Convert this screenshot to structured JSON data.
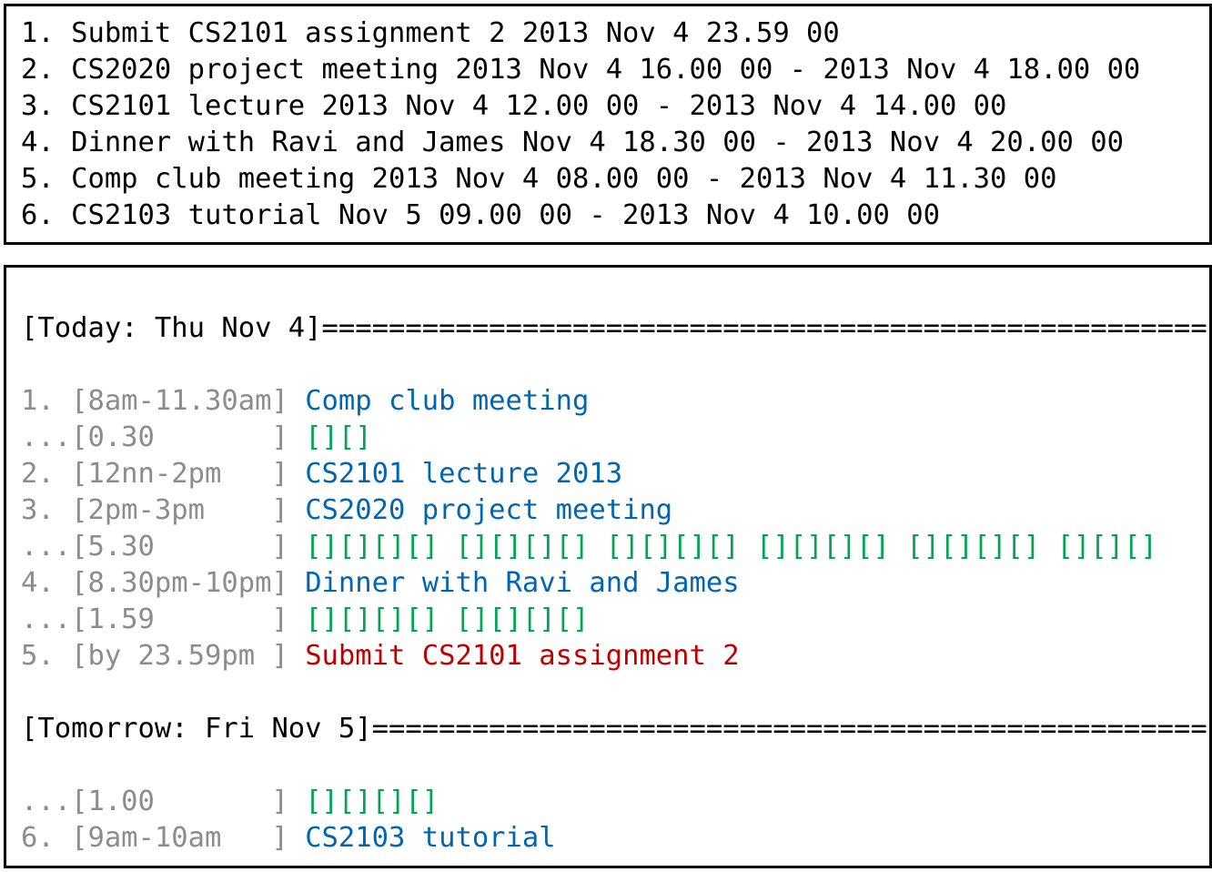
{
  "input_lines": [
    "1. Submit CS2101 assignment 2 2013 Nov 4 23.59 00",
    "2. CS2020 project meeting 2013 Nov 4 16.00 00 - 2013 Nov 4 18.00 00",
    "3. CS2101 lecture 2013 Nov 4 12.00 00 - 2013 Nov 4 14.00 00",
    "4. Dinner with Ravi and James Nov 4 18.30 00 - 2013 Nov 4 20.00 00",
    "5. Comp club meeting 2013 Nov 4 08.00 00 - 2013 Nov 4 11.30 00",
    "6. CS2103 tutorial Nov 5 09.00 00 - 2013 Nov 4 10.00 00"
  ],
  "today": {
    "header": "[Today: Thu Nov 4]=====================================================",
    "rows": [
      {
        "idx": "1. ",
        "time": "[8am-11.30am]",
        "text": "Comp club meeting"
      },
      {
        "idx": "...",
        "time": "[0.30       ]",
        "text": "[][]"
      },
      {
        "idx": "2. ",
        "time": "[12nn-2pm   ]",
        "text": "CS2101 lecture 2013"
      },
      {
        "idx": "3. ",
        "time": "[2pm-3pm    ]",
        "text": "CS2020 project meeting"
      },
      {
        "idx": "...",
        "time": "[5.30       ]",
        "text": "[][][][] [][][][] [][][][] [][][][] [][][][] [][][]"
      },
      {
        "idx": "4. ",
        "time": "[8.30pm-10pm]",
        "text": "Dinner with Ravi and James"
      },
      {
        "idx": "...",
        "time": "[1.59       ]",
        "text": "[][][][] [][][][]"
      },
      {
        "idx": "5. ",
        "time": "[by 23.59pm ]",
        "text": "Submit CS2101 assignment 2"
      }
    ]
  },
  "tomorrow": {
    "header": "[Tomorrow: Fri Nov 5]==================================================",
    "rows": [
      {
        "idx": "...",
        "time": "[1.00       ]",
        "text": "[][][][]"
      },
      {
        "idx": "6. ",
        "time": "[9am-10am   ]",
        "text": "CS2103 tutorial"
      }
    ]
  },
  "colors": {
    "task": "#0066b3",
    "deadline": "#c00000",
    "free_time": "#00a651",
    "index_time": "#8c8c8c"
  }
}
